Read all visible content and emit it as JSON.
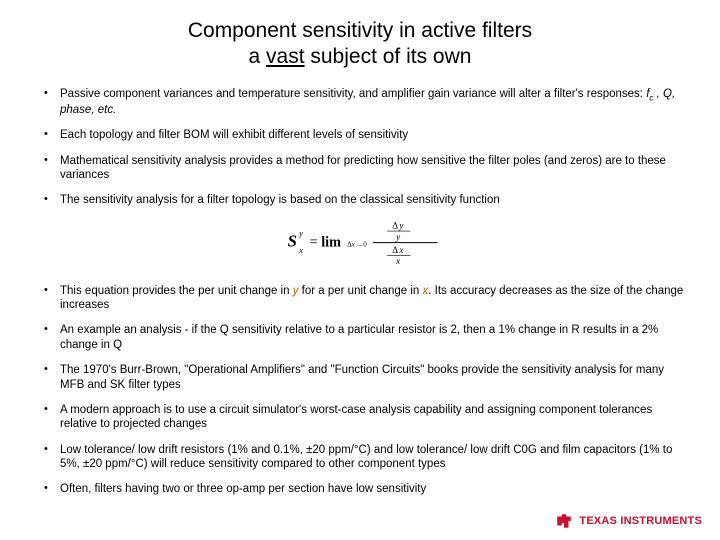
{
  "title": {
    "line1": "Component sensitivity in active filters",
    "line2_pre": "a ",
    "line2_underlined": "vast",
    "line2_post": " subject of its own"
  },
  "bullets": [
    {
      "pre": "Passive component variances and temperature sensitivity, and amplifier gain variance will alter a filter's responses: ",
      "ital": "f",
      "sub": "c",
      "post": " , Q, phase, etc."
    },
    {
      "text": "Each topology and filter BOM will exhibit different levels of sensitivity"
    },
    {
      "text": "Mathematical sensitivity analysis provides a method for predicting how sensitive the filter poles (and zeros) are to these variances"
    },
    {
      "text": "The sensitivity analysis for a filter topology is based on the classical sensitivity function"
    },
    {
      "pre": "This equation provides the per unit change in ",
      "var1": "y",
      "mid": " for a per unit change in ",
      "var2": "x",
      "post": ". Its accuracy decreases as the size of the change increases"
    },
    {
      "text": "An example an analysis - if the Q sensitivity relative to a particular resistor is 2, then a 1% change in R results in a 2% change in Q"
    },
    {
      "text": "The 1970's Burr-Brown, \"Operational Amplifiers\" and \"Function Circuits\" books provide the sensitivity analysis for many MFB and SK filter types"
    },
    {
      "text": "A modern approach is to use a circuit simulator's worst-case analysis capability and assigning component tolerances relative to projected changes"
    },
    {
      "text": "Low tolerance/ low drift resistors (1% and 0.1%, ±20 ppm/°C) and low tolerance/ low drift C0G and film capacitors (1% to 5%, ±20 ppm/°C) will reduce sensitivity compared to other component types"
    },
    {
      "text": "Often, filters having two or three op-amp per section have low sensitivity"
    }
  ],
  "equation": {
    "S": "S",
    "sup": "y",
    "sub": "x",
    "eq": "=",
    "lim": "lim",
    "limsub_pre": "Δ",
    "limsub_var": "x",
    "limsub_post": "→0",
    "num_d": "Δ",
    "num_var": "y",
    "num_den": "y",
    "den_d": "Δ",
    "den_var": "x",
    "den_den": "x"
  },
  "brand": "TEXAS INSTRUMENTS"
}
